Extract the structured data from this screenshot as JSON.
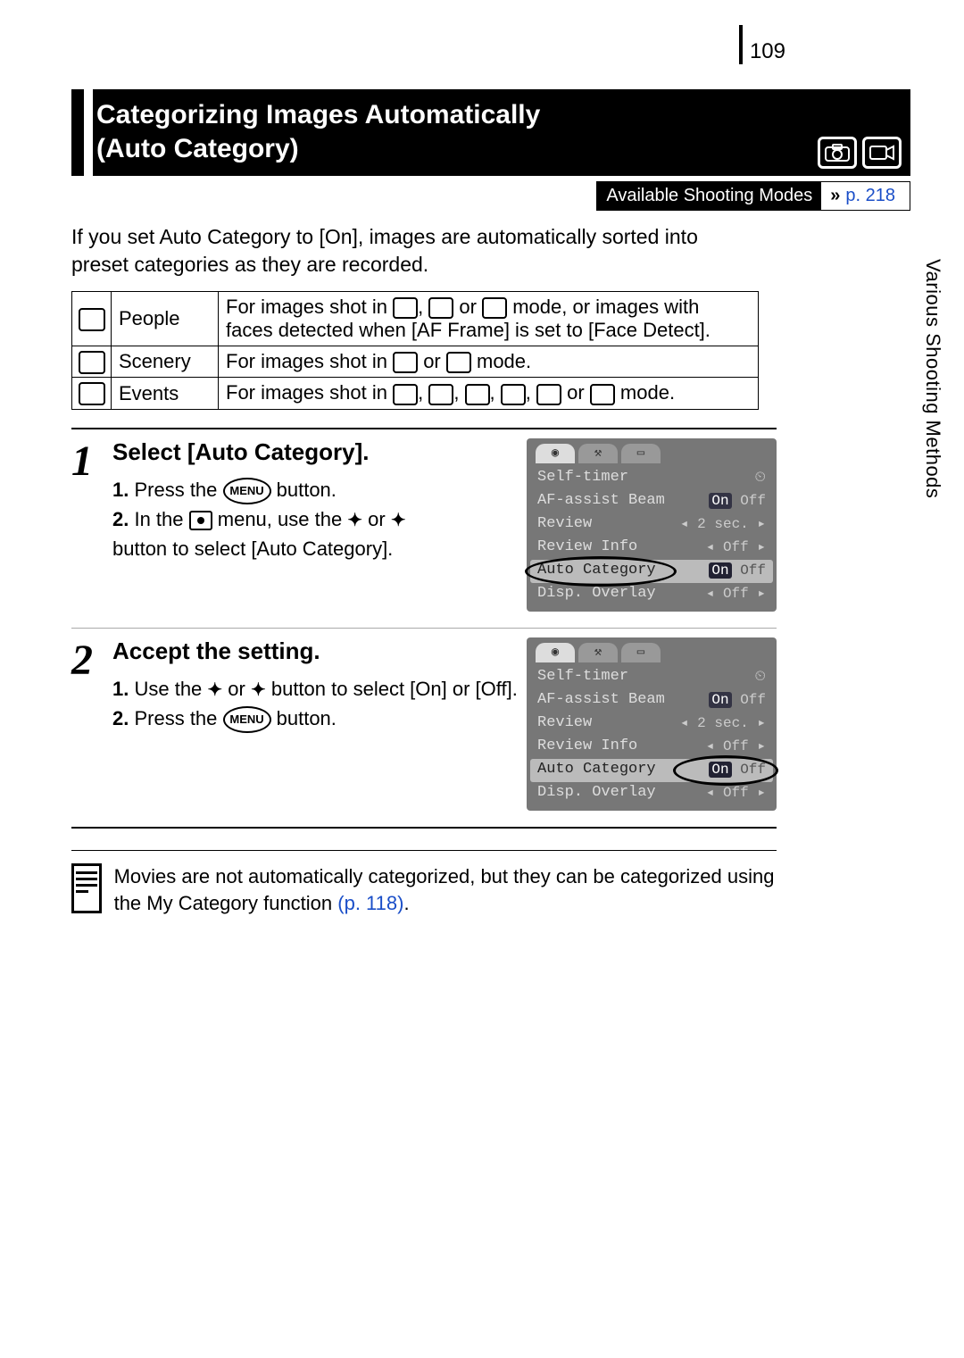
{
  "page_number": "109",
  "side_label": "Various Shooting Methods",
  "title_line1": "Categorizing Images Automatically",
  "title_line2": "(Auto Category)",
  "available_modes_label": "Available Shooting Modes",
  "available_modes_link": "p. 218",
  "intro": "If you set Auto Category to [On], images are automatically sorted into preset categories as they are recorded.",
  "categories": [
    {
      "name": "People",
      "desc_pre": "For images shot in ",
      "desc_mid": " or ",
      "desc_post": " mode, or images with faces detected when [AF Frame] is set to [Face Detect]."
    },
    {
      "name": "Scenery",
      "desc_pre": "For images shot in ",
      "desc_mid": " or ",
      "desc_post": " mode."
    },
    {
      "name": "Events",
      "desc_pre": "For images shot in ",
      "desc_mid": " or ",
      "desc_post": " mode."
    }
  ],
  "steps": [
    {
      "num": "1",
      "title": "Select [Auto Category].",
      "sub1_n": "1.",
      "sub1_a": " Press the ",
      "sub1_b": " button.",
      "sub2_n": "2.",
      "sub2_a": " In the ",
      "sub2_b": " menu, use the ",
      "sub2_c": " or ",
      "sub2_d": " button to select [Auto Category]."
    },
    {
      "num": "2",
      "title": "Accept the setting.",
      "sub1_n": "1.",
      "sub1_a": " Use the ",
      "sub1_b": " or ",
      "sub1_c": " button to select [On] or [Off].",
      "sub2_n": "2.",
      "sub2_a": " Press the ",
      "sub2_b": " button."
    }
  ],
  "menu_button_label": "MENU",
  "lcd": {
    "rows": [
      {
        "lab": "Self-timer",
        "val": ""
      },
      {
        "lab": "AF-assist Beam",
        "val_on": "On",
        "val_off": "Off"
      },
      {
        "lab": "Review",
        "val": "2 sec."
      },
      {
        "lab": "Review Info",
        "val": "Off"
      },
      {
        "lab": "Auto Category",
        "val_on": "On",
        "val_off": "Off"
      },
      {
        "lab": "Disp. Overlay",
        "val": "Off"
      }
    ]
  },
  "note": {
    "text_a": "Movies are not automatically categorized, but they can be categorized using the My Category function ",
    "link": "(p. 118)",
    "text_b": "."
  }
}
